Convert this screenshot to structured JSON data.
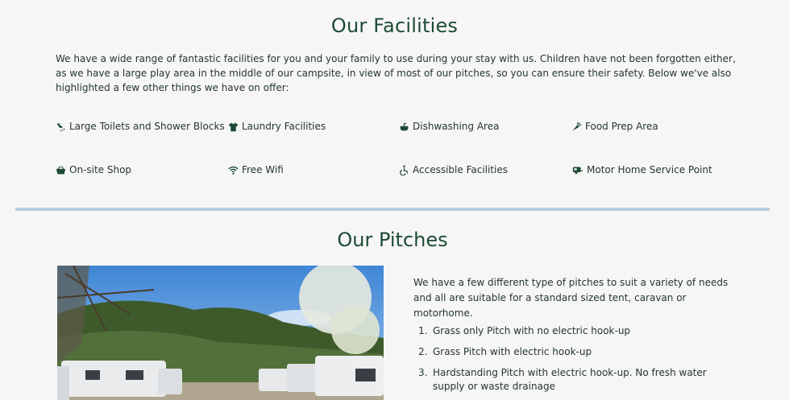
{
  "facilities": {
    "title": "Our Facilities",
    "intro": "We have a wide range of fantastic facilities for you and your family to use during your stay with us. Children have not been forgotten either, as we have a large play area in the middle of our campsite, in view of most of our pitches, so you can ensure their safety. Below we've also highlighted a few other things we have on offer:",
    "items": [
      {
        "label": "Large Toilets and Shower Blocks",
        "icon": "shower-icon"
      },
      {
        "label": "Laundry Facilities",
        "icon": "shirt-icon"
      },
      {
        "label": "Dishwashing Area",
        "icon": "sink-icon"
      },
      {
        "label": "Food Prep Area",
        "icon": "carrot-icon"
      },
      {
        "label": "On-site Shop",
        "icon": "basket-icon"
      },
      {
        "label": "Free Wifi",
        "icon": "wifi-icon"
      },
      {
        "label": "Accessible Facilities",
        "icon": "wheelchair-icon"
      },
      {
        "label": "Motor Home Service Point",
        "icon": "caravan-icon"
      }
    ]
  },
  "pitches": {
    "title": "Our Pitches",
    "intro": "We have a few different type of pitches to suit a variety of needs and all are suitable for a standard sized tent, caravan or motorhome.",
    "list": [
      {
        "num": "1.",
        "text": "Grass only Pitch with no electric hook-up"
      },
      {
        "num": "2.",
        "text": "Grass Pitch with electric hook-up"
      },
      {
        "num": "3.",
        "text": "Hardstanding Pitch with electric hook-up. No fresh water supply or waste drainage"
      }
    ]
  },
  "colors": {
    "accent": "#1d4a33",
    "divider": "#b8cde0",
    "background": "#f6f6f6"
  }
}
